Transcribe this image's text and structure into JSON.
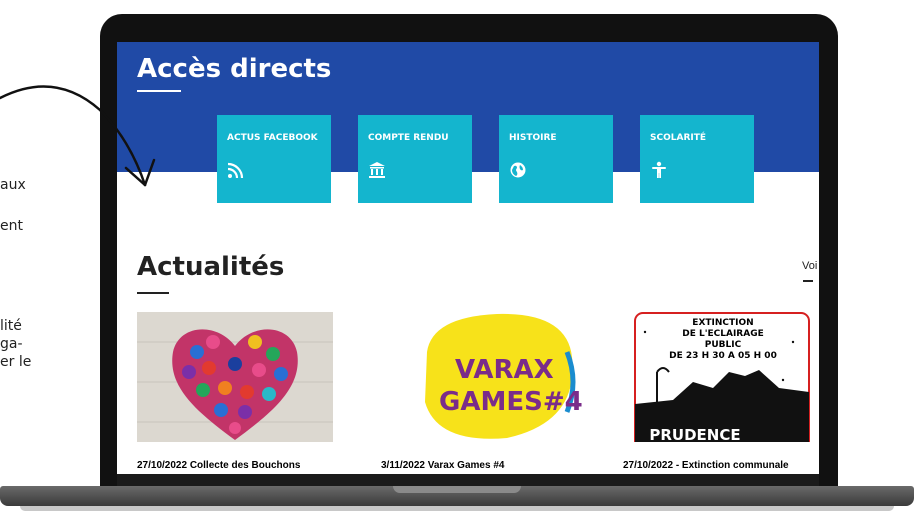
{
  "side_text": {
    "line1": "aux",
    "line2": "ent",
    "line3": "lité",
    "line4": "ga-",
    "line5": "er le"
  },
  "banner": {
    "title": "Accès directs",
    "color": "#204aa6"
  },
  "tiles": [
    {
      "label": "ACTUS FACEBOOK",
      "icon": "rss-icon"
    },
    {
      "label": "COMPTE RENDU",
      "icon": "institution-icon"
    },
    {
      "label": "HISTOIRE",
      "icon": "globe-icon"
    },
    {
      "label": "SCOLARITÉ",
      "icon": "child-icon"
    }
  ],
  "tile_color": "#14b5ce",
  "news": {
    "title": "Actualités",
    "more_link": "Voi",
    "items": [
      {
        "caption": "27/10/2022 Collecte des Bouchons",
        "image": "bottle-caps-heart-image"
      },
      {
        "caption": "3/11/2022 Varax Games #4",
        "image": "varax-games-logo-image",
        "image_text": [
          "VARAX",
          "GAMES#4"
        ]
      },
      {
        "caption": "27/10/2022 - Extinction communale",
        "image": "street-light-poster-image",
        "image_text": [
          "EXTINCTION",
          "DE L'ECLAIRAGE",
          "PUBLIC",
          "DE 23 H 30 A 05 H 00",
          "PRUDENCE"
        ]
      }
    ]
  }
}
